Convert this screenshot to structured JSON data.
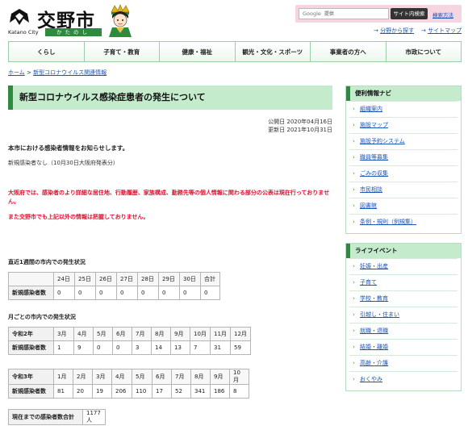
{
  "header": {
    "logo_text": "交野市",
    "logo_en": "Katano City",
    "logo_jp": "かたのし",
    "search_brand": "Google",
    "search_placeholder": "提供",
    "search_button": "サイト内検索",
    "search_help": "検索方法",
    "links": [
      "分野から探す",
      "サイトマップ"
    ]
  },
  "nav": {
    "items": [
      "くらし",
      "子育て・教育",
      "健康・福祉",
      "観光・文化・スポーツ",
      "事業者の方へ",
      "市政について"
    ]
  },
  "breadcrumb": {
    "home": "ホーム",
    "sep": ">",
    "current": "新型コロナウイルス関連情報"
  },
  "main": {
    "title": "新型コロナウイルス感染症患者の発生について",
    "published": "公開日 2020年04月16日",
    "updated": "更新日 2021年10月31日",
    "intro": "本市における感染者情報をお知らせします。",
    "latest": "新規感染者なし（10月30日大阪府発表分）",
    "red_notice_1": "大阪府では、感染者のより詳細な居住地、行動履歴、家族構成、勤務先等の個人情報に関わる部分の公表は現在行っておりません。",
    "red_notice_2": "また交野市でも上記以外の情報は把握しておりません。",
    "weekly": {
      "title": "直近1週間の市内での発生状況",
      "headers": [
        "24日",
        "25日",
        "26日",
        "27日",
        "28日",
        "29日",
        "30日",
        "合計"
      ],
      "row_label": "新規感染者数",
      "values": [
        "0",
        "0",
        "0",
        "0",
        "0",
        "0",
        "0",
        "0"
      ]
    },
    "monthly_title": "月ごとの市内での発生状況",
    "r2": {
      "year": "令和2年",
      "months": [
        "3月",
        "4月",
        "5月",
        "6月",
        "7月",
        "8月",
        "9月",
        "10月",
        "11月",
        "12月"
      ],
      "row_label": "新規感染者数",
      "values": [
        "1",
        "9",
        "0",
        "0",
        "3",
        "14",
        "13",
        "7",
        "31",
        "59"
      ]
    },
    "r3": {
      "year": "令和3年",
      "months": [
        "1月",
        "2月",
        "3月",
        "4月",
        "5月",
        "6月",
        "7月",
        "8月",
        "9月",
        "10月"
      ],
      "row_label": "新規感染者数",
      "values": [
        "81",
        "20",
        "19",
        "206",
        "110",
        "17",
        "52",
        "341",
        "186",
        "8"
      ]
    },
    "total": {
      "label": "現在までの感染者数合計",
      "value": "1177人"
    }
  },
  "sidebar": {
    "navi_title": "便利情報ナビ",
    "navi_items": [
      "組織案内",
      "施設マップ",
      "施設予約システム",
      "職員等募集",
      "ごみの収集",
      "市民相談",
      "図書館",
      "条例・規則（例規集）"
    ],
    "life_title": "ライフイベント",
    "life_items": [
      "妊娠・出産",
      "子育て",
      "学校・教育",
      "引越し・住まい",
      "就職・退職",
      "結婚・離婚",
      "高齢・介護",
      "おくやみ"
    ]
  },
  "colors": {
    "accent_green": "#2e8a3f",
    "title_bg": "#c3ebcc",
    "link": "#1a55b5",
    "alert_red": "#e0102f",
    "search_bg": "#f6d5e0"
  }
}
